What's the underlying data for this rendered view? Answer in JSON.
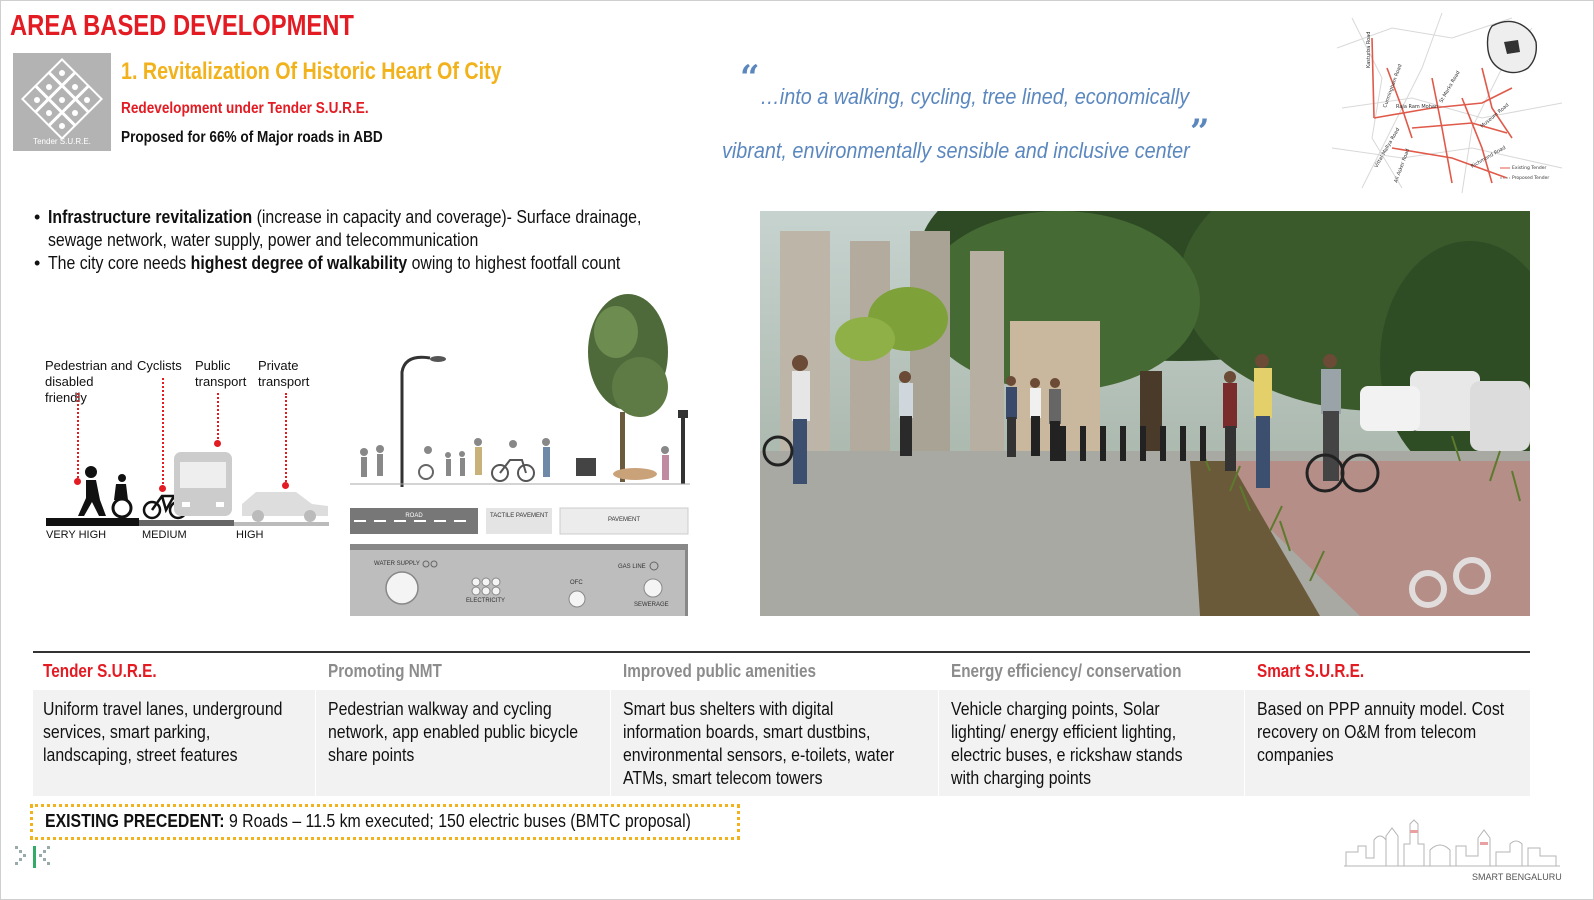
{
  "header": {
    "title": "AREA BASED DEVELOPMENT",
    "subtitle": "1. Revitalization Of Historic Heart Of City",
    "line2": "Redevelopment under Tender S.U.R.E.",
    "line3": "Proposed for 66% of Major roads in ABD",
    "logo_caption": "Tender S.U.R.E."
  },
  "quote": {
    "line1": "…into a walking, cycling, tree lined, economically",
    "line2": "vibrant, environmentally sensible and inclusive center",
    "open_mark": "“",
    "close_mark": "”"
  },
  "map": {
    "labels": [
      "Kasturba Road",
      "Cunningham Road",
      "Raja Ram Mohan Roy Road",
      "St Marks Road",
      "Museum Road",
      "Vittal Mallya Road",
      "Ali Asker Road",
      "Richmond Road",
      "Residency Road"
    ],
    "legend": [
      "Existing Tender S.U.R.E Roads",
      "Proposed Tender S.U.R.E Roads"
    ]
  },
  "bullets": [
    {
      "bold": "Infrastructure revitalization",
      "text": " (increase in capacity and coverage)- Surface drainage, sewage network, water supply, power and telecommunication"
    },
    {
      "pre": "The city core needs ",
      "bold": "highest degree of walkability",
      "text": " owing to highest footfall count"
    }
  ],
  "priority": {
    "categories": [
      "Pedestrian and disabled friendly",
      "Cyclists",
      "Public transport",
      "Private transport"
    ],
    "levels": [
      "VERY HIGH",
      "MEDIUM",
      "HIGH"
    ]
  },
  "section": {
    "road": "ROAD",
    "tactile": "TACTILE PAVEMENT",
    "pavement": "PAVEMENT",
    "water": "WATER SUPPLY",
    "gas": "GAS LINE",
    "electricity": "ELECTRICITY",
    "ofc": "OFC",
    "sewerage": "SEWERAGE"
  },
  "table": {
    "headers": [
      {
        "text": "Tender S.U.R.E.",
        "color": "#e31b23"
      },
      {
        "text": "Promoting NMT",
        "color": "#8c8c8c"
      },
      {
        "text": "Improved public amenities",
        "color": "#8c8c8c"
      },
      {
        "text": "Energy efficiency/ conservation",
        "color": "#8c8c8c"
      },
      {
        "text": "Smart S.U.R.E.",
        "color": "#e31b23"
      }
    ],
    "cells": [
      [
        "Uniform travel lanes, underground",
        "services, smart parking,",
        "landscaping, street features"
      ],
      [
        "Pedestrian walkway and cycling",
        "network, app enabled public bicycle",
        "share points"
      ],
      [
        "Smart bus shelters with digital",
        "information boards, smart dustbins,",
        "environmental sensors, e-toilets, water",
        "ATMs, smart telecom towers"
      ],
      [
        "Vehicle charging points, Solar",
        "lighting/ energy efficient lighting,",
        "electric buses, e rickshaw stands",
        "with charging points"
      ],
      [
        "Based on PPP annuity model. Cost",
        "recovery on O&M from telecom",
        "companies"
      ]
    ]
  },
  "precedent": {
    "label": "EXISTING PRECEDENT:",
    "text": " 9 Roads – 11.5 km executed; 150 electric buses (BMTC proposal)"
  },
  "footer": {
    "brand": "SMART BENGALURU"
  },
  "colors": {
    "red": "#e31b23",
    "yellow": "#f2b21b",
    "quote_blue": "#5b87bf"
  }
}
